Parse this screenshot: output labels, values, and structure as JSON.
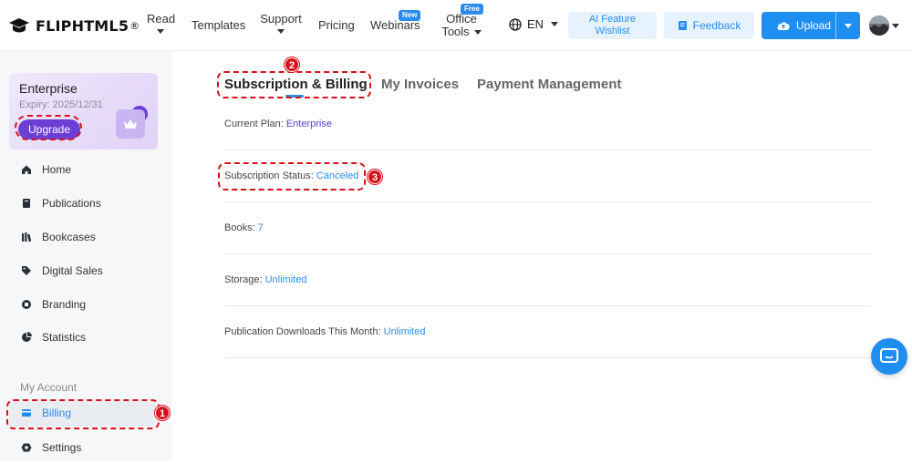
{
  "brand": {
    "name": "FLIPHTML5",
    "mark": "®"
  },
  "nav": {
    "read": "Read",
    "templates": "Templates",
    "support": "Support",
    "pricing": "Pricing",
    "webinars": "Webinars",
    "webinars_badge": "New",
    "office_line1": "Office",
    "office_line2": "Tools",
    "office_badge": "Free"
  },
  "header": {
    "language": "EN",
    "ai_line1": "AI Feature",
    "ai_line2": "Wishlist",
    "feedback": "Feedback",
    "upload": "Upload"
  },
  "plan": {
    "title": "Enterprise",
    "expiry": "Expiry: 2025/12/31",
    "upgrade": "Upgrade"
  },
  "sidebar": {
    "items": [
      {
        "label": "Home",
        "icon": "home-icon"
      },
      {
        "label": "Publications",
        "icon": "book-icon"
      },
      {
        "label": "Bookcases",
        "icon": "bookcase-icon"
      },
      {
        "label": "Digital Sales",
        "icon": "tag-icon"
      },
      {
        "label": "Branding",
        "icon": "brand-icon"
      },
      {
        "label": "Statistics",
        "icon": "pie-chart-icon"
      }
    ],
    "section": "My Account",
    "billing": "Billing",
    "settings": "Settings"
  },
  "tabs": [
    "Subscription & Billing",
    "My Invoices",
    "Payment Management"
  ],
  "details": [
    {
      "label": "Current Plan:",
      "value": "Enterprise"
    },
    {
      "label": "Subscription Status:",
      "value": "Canceled"
    },
    {
      "label": "Books:",
      "value": "7"
    },
    {
      "label": "Storage:",
      "value": "Unlimited"
    },
    {
      "label": "Publication Downloads This Month:",
      "value": "Unlimited"
    }
  ],
  "annotations": [
    "1",
    "2",
    "3"
  ],
  "colors": {
    "accent": "#2a8cf0",
    "upgrade": "#6b3fd4",
    "annotation": "#d8101a"
  }
}
